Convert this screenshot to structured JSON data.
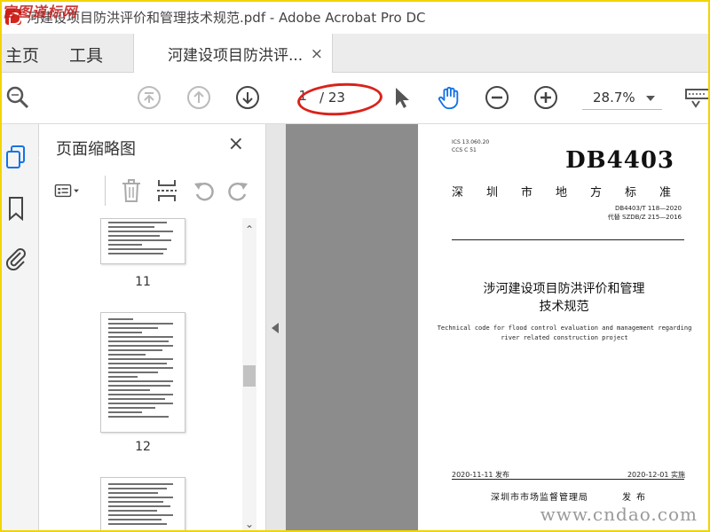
{
  "window": {
    "title": "河建设项目防洪评价和管理技术规范.pdf - Adobe Acrobat Pro DC",
    "watermark_top": "官图道标网"
  },
  "tabs": {
    "home": "主页",
    "tools": "工具",
    "document": "河建设项目防洪评...",
    "close": "×"
  },
  "toolbar": {
    "page_current": "1",
    "page_total": "/ 23",
    "zoom": "28.7%"
  },
  "thumbnail_panel": {
    "title": "页面缩略图",
    "close": "×",
    "pages": [
      {
        "label": "11"
      },
      {
        "label": "12"
      },
      {
        "label": ""
      }
    ]
  },
  "pdf_page": {
    "ics_line1": "ICS 13.060.20",
    "ics_line2": "CCS C 51",
    "db_code": "DB4403",
    "standard_type": "深圳市地方标准",
    "std_number": "DB4403/T 118—2020",
    "replaces": "代替 SZDB/Z 215—2016",
    "title_line1": "涉河建设项目防洪评价和管理",
    "title_line2": "技术规范",
    "english_line1": "Technical code for flood control evaluation and management regarding",
    "english_line2": "river related construction project",
    "publish_date": "2020-11-11 发布",
    "implement_date": "2020-12-01 实施",
    "issuer": "深圳市市场监督管理局",
    "publish_word": "发布"
  },
  "watermark_bottom": "www.cndao.com",
  "colors": {
    "accent": "#1473e6",
    "annotation": "#d9221b",
    "frame": "#f2d400"
  }
}
